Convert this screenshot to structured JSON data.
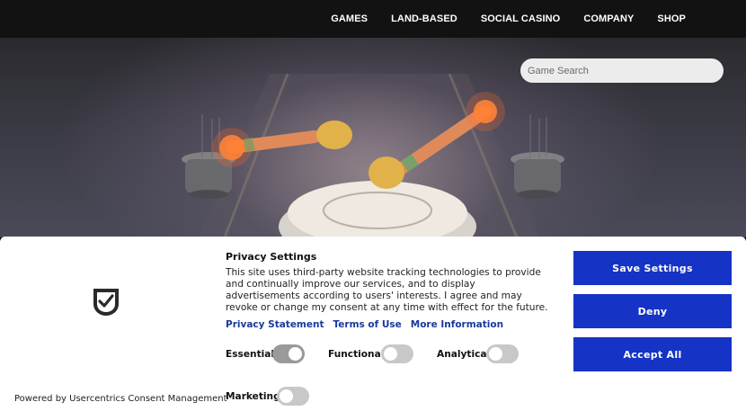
{
  "nav": {
    "items": [
      {
        "label": "GAMES"
      },
      {
        "label": "LAND-BASED"
      },
      {
        "label": "SOCIAL CASINO"
      },
      {
        "label": "COMPANY"
      },
      {
        "label": "SHOP"
      }
    ]
  },
  "search": {
    "placeholder": "Game Search"
  },
  "consent": {
    "title": "Privacy Settings",
    "description": "This site uses third-party website tracking technologies to provide and continually improve our services, and to display advertisements according to users' interests. I agree and may revoke or change my consent at any time with effect for the future.",
    "links": {
      "privacy": "Privacy Statement",
      "terms": "Terms of Use",
      "more": "More Information"
    },
    "toggles": {
      "essential": {
        "label": "Essential",
        "enabled": true
      },
      "functional": {
        "label": "Functional",
        "enabled": false
      },
      "analytical": {
        "label": "Analytical",
        "enabled": false
      },
      "marketing": {
        "label": "Marketing",
        "enabled": false
      }
    },
    "buttons": {
      "save": "Save Settings",
      "deny": "Deny",
      "accept": "Accept All"
    },
    "powered_by": "Powered by Usercentrics Consent Management",
    "logo_icon": "usercentrics-shield-icon",
    "accent_color": "#1533c4"
  }
}
